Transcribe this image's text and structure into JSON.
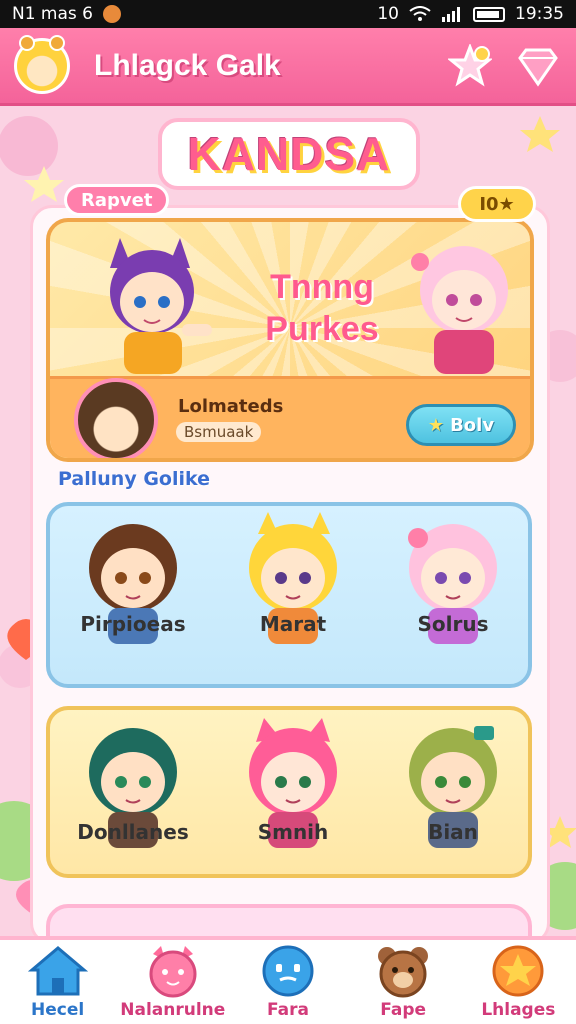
{
  "status_bar": {
    "left_text": "N1 mas 6",
    "right_text": "10",
    "time": "19:35"
  },
  "header": {
    "title": "Lhlagck Galk",
    "icons": [
      "star-badge-icon",
      "heart-gem-icon"
    ]
  },
  "logo": {
    "text": "KANDSA"
  },
  "featured": {
    "tag": "Rapvet",
    "badge": "I0★",
    "title_line1": "Tnnng",
    "title_line2": "Purkes",
    "name": "Lolmateds",
    "subtitle": "Bsmuaak",
    "button_label": "Bolv",
    "button_star": "★"
  },
  "section": {
    "label": "Palluny Golike"
  },
  "blue_row": {
    "characters": [
      {
        "name": "Pirpioeas",
        "hair": "#6b3a1f",
        "skin": "#ffe0c4",
        "shirt": "#4b78b6"
      },
      {
        "name": "Marat",
        "hair": "#ffd63a",
        "skin": "#ffe6cc",
        "shirt": "#f08a3a"
      },
      {
        "name": "Solrus",
        "hair": "#ffc2de",
        "skin": "#ffe9d6",
        "shirt": "#c46bd6"
      }
    ]
  },
  "yellow_row": {
    "characters": [
      {
        "name": "Donllanes",
        "hair": "#1e6b5e",
        "skin": "#ffe0c4",
        "shirt": "#6b4a3a"
      },
      {
        "name": "Smnih",
        "hair": "#ff5d97",
        "skin": "#ffe6d6",
        "shirt": "#d64a7a"
      },
      {
        "name": "Bian",
        "hair": "#9cb04a",
        "skin": "#ffe0c4",
        "shirt": "#5a6a8a"
      }
    ]
  },
  "nav": {
    "items": [
      {
        "label": "Hecel",
        "icon": "home-icon",
        "active": true
      },
      {
        "label": "Nalanrulne",
        "icon": "pink-cat-icon",
        "active": false
      },
      {
        "label": "Fara",
        "icon": "blue-face-icon",
        "active": false
      },
      {
        "label": "Fape",
        "icon": "bear-icon",
        "active": false
      },
      {
        "label": "Lhlages",
        "icon": "badge-icon",
        "active": false
      }
    ]
  },
  "colors": {
    "header": "#f4639a",
    "accent_blue": "#2b75c9",
    "panel_border": "#ffc8da"
  }
}
